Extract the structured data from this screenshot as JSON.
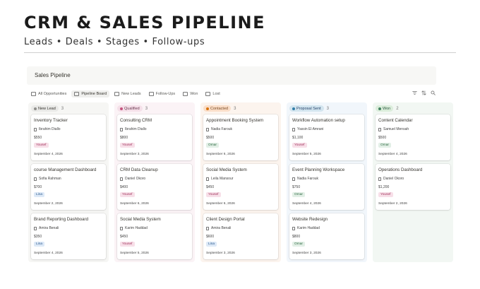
{
  "hero": {
    "title": "CRM & SALES PIPELINE",
    "subtitle": "Leads • Deals • Stages • Follow-ups"
  },
  "board": {
    "title": "Sales Pipeline"
  },
  "views": [
    {
      "label": "All Opportunities",
      "active": false
    },
    {
      "label": "Pipeline Board",
      "active": true
    },
    {
      "label": "New Leads",
      "active": false
    },
    {
      "label": "Follow-Ups",
      "active": false
    },
    {
      "label": "Won",
      "active": false
    },
    {
      "label": "Lost",
      "active": false
    }
  ],
  "toolbar_icons": [
    "filter-icon",
    "sort-icon",
    "search-icon"
  ],
  "owner_colors": {
    "Yousef": {
      "bg": "#f7dfe8",
      "fg": "#a3375f"
    },
    "Lina": {
      "bg": "#dde9f7",
      "fg": "#2c5b8f"
    },
    "Omar": {
      "bg": "#e2efe6",
      "fg": "#2f6a43"
    }
  },
  "columns": [
    {
      "name": "New Lead",
      "count": "3",
      "colors": {
        "bg": "#f6f6f4",
        "pill": "#e9e9e7",
        "pill_text": "#37352f",
        "dot": "#8f8f8c"
      },
      "cards": [
        {
          "title": "Inventory Tracker",
          "contact": "Ibrahim Diallo",
          "amount": "$550",
          "owner": "Yousef",
          "date": "September 4, 2026"
        },
        {
          "title": "course Management Dashboard",
          "contact": "Sofia Rahman",
          "amount": "$700",
          "owner": "Lina",
          "date": "September 2, 2026"
        },
        {
          "title": "Brand Reporting Dashboard",
          "contact": "Amira Benali",
          "amount": "$350",
          "owner": "Lina",
          "date": "September 4, 2026"
        }
      ]
    },
    {
      "name": "Qualified",
      "count": "3",
      "colors": {
        "bg": "#fbf3f6",
        "pill": "#f5e0e9",
        "pill_text": "#6b3850",
        "dot": "#c4557f"
      },
      "cards": [
        {
          "title": "Consulting CRM",
          "contact": "Ibrahim Diallo",
          "amount": "$800",
          "owner": "Yousef",
          "date": "September 3, 2026"
        },
        {
          "title": "CRM Data Cleanup",
          "contact": "Daniel Okoro",
          "amount": "$400",
          "owner": "Yousef",
          "date": "September 6, 2026"
        },
        {
          "title": "Social Media System",
          "contact": "Karim Haddad",
          "amount": "$450",
          "owner": "Yousef",
          "date": "September 5, 2026"
        }
      ]
    },
    {
      "name": "Contacted",
      "count": "3",
      "colors": {
        "bg": "#fcf4ee",
        "pill": "#fadec9",
        "pill_text": "#7a4a22",
        "dot": "#d9730d"
      },
      "cards": [
        {
          "title": "Appointment Booking System",
          "contact": "Nadia Farouk",
          "amount": "$500",
          "owner": "Omar",
          "date": "September 6, 2026"
        },
        {
          "title": "Social Media System",
          "contact": "Leila Mansour",
          "amount": "$450",
          "owner": "Yousef",
          "date": "September 6, 2026"
        },
        {
          "title": "Client Design Portal",
          "contact": "Amira Benali",
          "amount": "$600",
          "owner": "Lina",
          "date": "September 3, 2026"
        }
      ]
    },
    {
      "name": "Proposal Sent",
      "count": "3",
      "colors": {
        "bg": "#f1f6fb",
        "pill": "#d3e5ef",
        "pill_text": "#28456c",
        "dot": "#337ea9"
      },
      "cards": [
        {
          "title": "Workflow Automation setup",
          "contact": "Yassin El Amrani",
          "amount": "$1,100",
          "owner": "Yousef",
          "date": "September 5, 2026"
        },
        {
          "title": "Event Planning Workspace",
          "contact": "Nadia Farouk",
          "amount": "$750",
          "owner": "Omar",
          "date": "September 4, 2026"
        },
        {
          "title": "Website Redesign",
          "contact": "Karim Haddad",
          "amount": "$800",
          "owner": "Omar",
          "date": "September 3, 2026"
        }
      ]
    },
    {
      "name": "Won",
      "count": "2",
      "colors": {
        "bg": "#f2f7f3",
        "pill": "#dbeddb",
        "pill_text": "#2b593f",
        "dot": "#448361"
      },
      "cards": [
        {
          "title": "Content Calendar",
          "contact": "Samuel Mensah",
          "amount": "$500",
          "owner": "Omar",
          "date": "September 4, 2026"
        },
        {
          "title": "Operations Dashboard",
          "contact": "Daniel Okoro",
          "amount": "$1,200",
          "owner": "Yousef",
          "date": "September 2, 2026"
        }
      ]
    }
  ]
}
